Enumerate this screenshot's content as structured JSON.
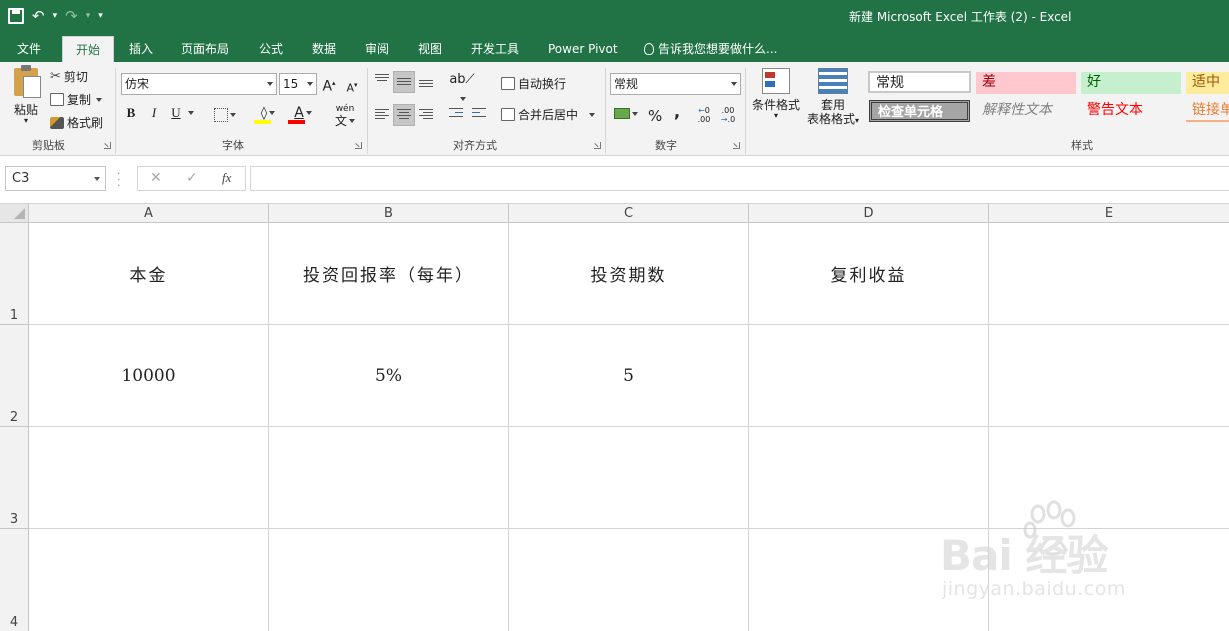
{
  "window": {
    "title": "新建 Microsoft Excel 工作表 (2) - Excel"
  },
  "qat": {
    "save_icon": "save-icon",
    "undo_icon": "undo-icon",
    "redo_icon": "redo-icon",
    "customize_icon": "customize-icon"
  },
  "tabs": [
    {
      "label": "文件"
    },
    {
      "label": "开始",
      "active": true
    },
    {
      "label": "插入"
    },
    {
      "label": "页面布局"
    },
    {
      "label": "公式"
    },
    {
      "label": "数据"
    },
    {
      "label": "审阅"
    },
    {
      "label": "视图"
    },
    {
      "label": "开发工具"
    },
    {
      "label": "Power Pivot"
    }
  ],
  "tell_me": "告诉我您想要做什么...",
  "clipboard": {
    "paste": "粘贴",
    "cut": "剪切",
    "copy": "复制",
    "format_painter": "格式刷",
    "group": "剪贴板"
  },
  "font": {
    "name": "仿宋",
    "size": "15",
    "grow": "A",
    "shrink": "A",
    "bold": "B",
    "italic": "I",
    "underline": "U",
    "font_color_letter": "A",
    "phonetic": "wén",
    "group": "字体",
    "fill_color": "#ffff00",
    "font_color": "#ff0000"
  },
  "alignment": {
    "wrap_text": "自动换行",
    "merge_center": "合并后居中",
    "group": "对齐方式"
  },
  "number": {
    "format": "常规",
    "percent": "%",
    "comma": ",",
    "inc_decimal": ".00",
    "dec_decimal": ".0",
    "group": "数字"
  },
  "styles": {
    "conditional_formatting": "条件格式",
    "format_as_table_line1": "套用",
    "format_as_table_line2": "表格格式",
    "cell_styles": [
      {
        "label": "常规"
      },
      {
        "label": "差",
        "bg": "#ffc7ce",
        "fg": "#9c0006"
      },
      {
        "label": "好",
        "bg": "#c6efce",
        "fg": "#006100"
      },
      {
        "label": "适中",
        "bg": "#ffeb9c",
        "fg": "#9c5700"
      },
      {
        "label": "检查单元格"
      },
      {
        "label": "解释性文本"
      },
      {
        "label": "警告文本"
      },
      {
        "label": "链接单"
      }
    ],
    "group": "样式"
  },
  "formula_bar": {
    "name_box": "C3",
    "cancel": "✕",
    "enter": "✓",
    "fx": "fx",
    "value": ""
  },
  "sheet": {
    "columns": [
      "A",
      "B",
      "C",
      "D",
      "E"
    ],
    "rows": [
      "1",
      "2",
      "3",
      "4"
    ],
    "cells": [
      [
        "本金",
        "投资回报率（每年）",
        "投资期数",
        "复利收益",
        ""
      ],
      [
        "10000",
        "5%",
        "5",
        "",
        ""
      ],
      [
        "",
        "",
        "",
        "",
        ""
      ],
      [
        "",
        "",
        "",
        "",
        ""
      ]
    ]
  },
  "watermark": {
    "logo": "Bai  经验",
    "url": "jingyan.baidu.com"
  }
}
